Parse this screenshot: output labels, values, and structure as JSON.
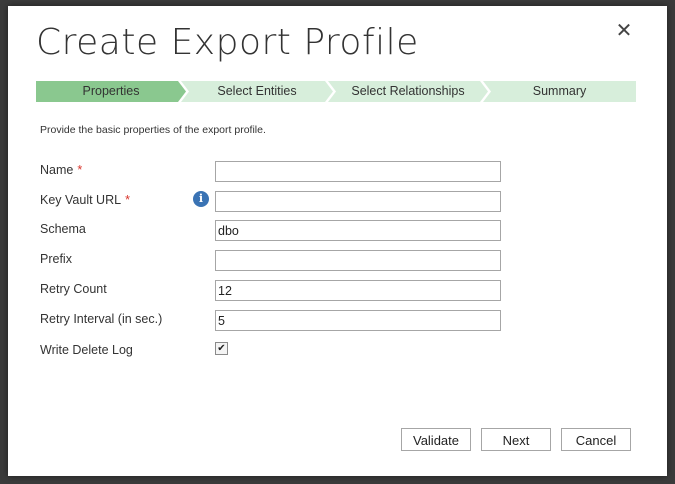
{
  "dialog": {
    "title": "Create Export Profile",
    "close_label": "✕"
  },
  "steps": [
    {
      "label": "Properties",
      "active": true
    },
    {
      "label": "Select Entities",
      "active": false
    },
    {
      "label": "Select Relationships",
      "active": false
    },
    {
      "label": "Summary",
      "active": false
    }
  ],
  "description": "Provide the basic properties of the export profile.",
  "form": {
    "required_mark": "*",
    "info_glyph": "i",
    "name": {
      "label": "Name",
      "value": ""
    },
    "key_vault_url": {
      "label": "Key Vault URL",
      "value": ""
    },
    "schema": {
      "label": "Schema",
      "value": "dbo"
    },
    "prefix": {
      "label": "Prefix",
      "value": ""
    },
    "retry_count": {
      "label": "Retry Count",
      "value": "12"
    },
    "retry_interval": {
      "label": "Retry Interval (in sec.)",
      "value": "5"
    },
    "write_delete_log": {
      "label": "Write Delete Log",
      "checked": true,
      "check_glyph": "✔"
    }
  },
  "buttons": {
    "validate": "Validate",
    "next": "Next",
    "cancel": "Cancel"
  },
  "colors": {
    "step_active": "#8ac88f",
    "step_inactive": "#d7eedb",
    "required": "#d9342b",
    "info_icon": "#3a73b4"
  }
}
